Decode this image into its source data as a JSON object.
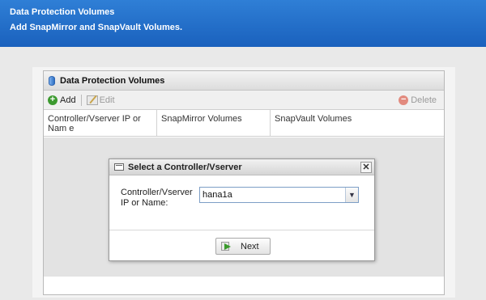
{
  "header": {
    "title": "Data Protection Volumes",
    "subtitle": "Add SnapMirror and SnapVault Volumes."
  },
  "panel": {
    "title": "Data Protection Volumes",
    "toolbar": {
      "add_label": "Add",
      "edit_label": "Edit",
      "delete_label": "Delete"
    },
    "columns": [
      "Controller/Vserver IP or Nam e",
      "SnapMirror Volumes",
      "SnapVault Volumes"
    ]
  },
  "dialog": {
    "title": "Select a Controller/Vserver",
    "field_label": "Controller/Vserver IP or Name:",
    "field_value": "hana1a",
    "next_label": "Next"
  },
  "colors": {
    "header_blue": "#1a61bd",
    "add_green": "#3c9a2f",
    "delete_red": "#e28a7e"
  }
}
